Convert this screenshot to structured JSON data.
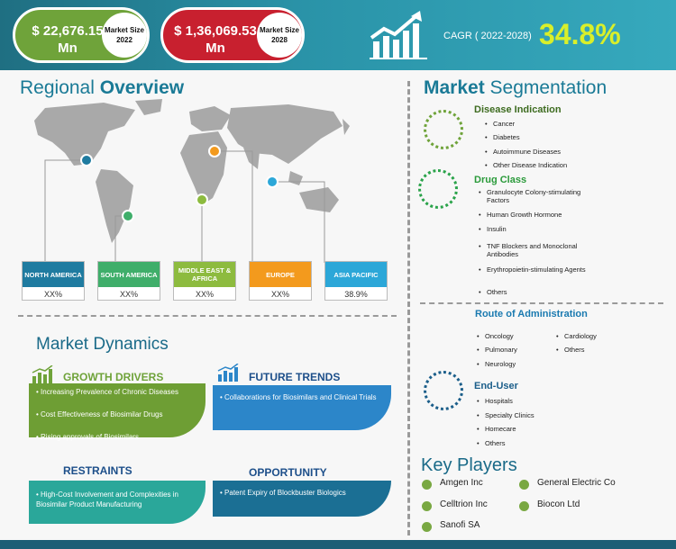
{
  "header": {
    "market_2022_value": "$ 22,676.15 Mn",
    "market_2022_label": "Market Size 2022",
    "market_2028_value": "$ 1,36,069.53 Mn",
    "market_2028_label": "Market Size 2028",
    "cagr_label": "CAGR ( 2022-2028)",
    "cagr_value": "34.8%",
    "colors": {
      "band": "#2a93a8",
      "green": "#6fa33a",
      "red": "#c8202f",
      "cagr": "#d9ef2a"
    }
  },
  "regional": {
    "title_a": "Regional ",
    "title_b": "Overview",
    "regions": [
      {
        "name": "NORTH AMERICA",
        "value": "XX%",
        "color": "#1f7ba0"
      },
      {
        "name": "SOUTH AMERICA",
        "value": "XX%",
        "color": "#3fae6a"
      },
      {
        "name": "MIDDLE EAST & AFRICA",
        "value": "XX%",
        "color": "#8dbb3f"
      },
      {
        "name": "EUROPE",
        "value": "XX%",
        "color": "#f39a1d"
      },
      {
        "name": "ASIA PACIFIC",
        "value": "38.9%",
        "color": "#2ca7d8"
      }
    ]
  },
  "dynamics": {
    "title": "Market Dynamics",
    "drivers_title": "GROWTH DRIVERS",
    "drivers": [
      "Increasing Prevalence of  Chronic Diseases",
      "Cost Effectiveness of Biosimilar Drugs",
      "Rising approvals of Biosimilars"
    ],
    "trends_title": "FUTURE TRENDS",
    "trends": [
      "Collaborations for Biosimilars and Clinical Trials"
    ],
    "restraints_title": "RESTRAINTS",
    "restraints": [
      "High-Cost Involvement and Complexities in Biosimilar Product Manufacturing"
    ],
    "opportunity_title": "OPPORTUNITY",
    "opportunity": [
      "Patent Expiry of Blockbuster Biologics"
    ]
  },
  "segmentation": {
    "title_a": "Market ",
    "title_b": "Segmentation",
    "disease": {
      "title": "Disease Indication",
      "items": [
        "Cancer",
        "Diabetes",
        "Autoimmune Diseases",
        "Other Disease Indication"
      ]
    },
    "drug": {
      "title": "Drug Class",
      "items": [
        "Granulocyte Colony-stimulating Factors",
        "Human Growth Hormone",
        "Insulin",
        "TNF Blockers and Monoclonal Antibodies",
        "Erythropoietin-stimulating Agents",
        "Others"
      ]
    },
    "route": {
      "title": "Route of Administration",
      "items": [
        "Oncology",
        "Cardiology",
        "Pulmonary",
        "Others",
        "Neurology"
      ]
    },
    "enduser": {
      "title": "End-User",
      "items": [
        "Hospitals",
        "Specialty Clinics",
        "Homecare",
        "Others"
      ]
    }
  },
  "key_players": {
    "title": "Key Players",
    "players": [
      "Amgen Inc",
      "General Electric Co",
      "Celltrion Inc",
      "Biocon Ltd",
      "Sanofi SA"
    ]
  }
}
